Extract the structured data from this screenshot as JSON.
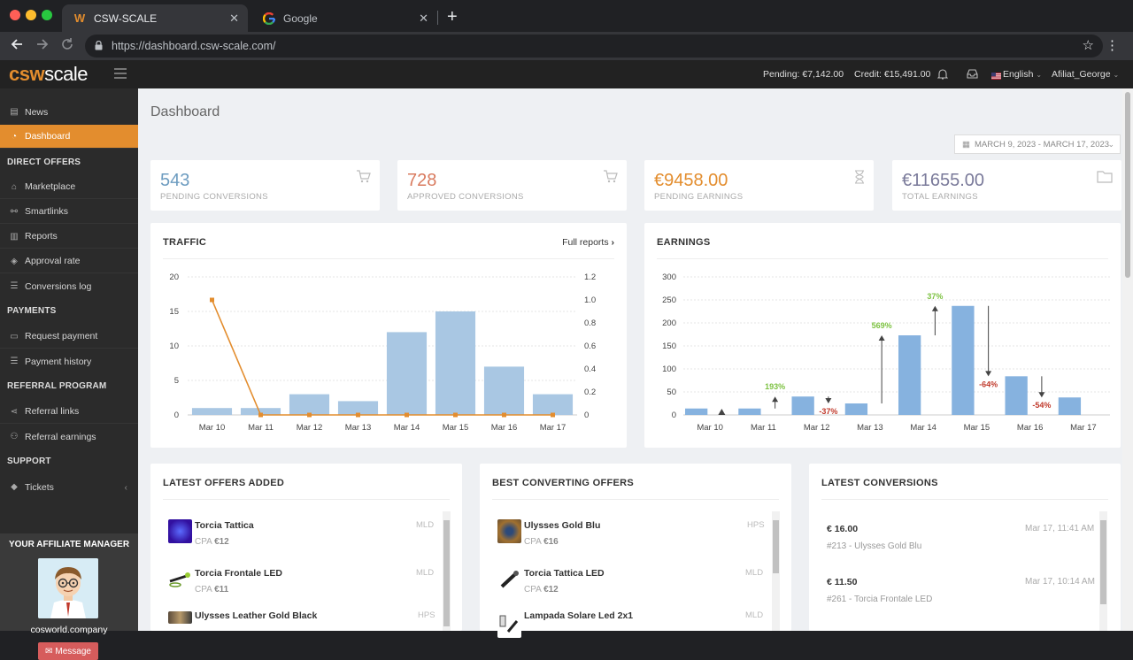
{
  "browser": {
    "tabs": [
      {
        "label": "CSW-SCALE",
        "active": true
      },
      {
        "label": "Google",
        "active": false
      }
    ],
    "url": "https://dashboard.csw-scale.com/"
  },
  "topbar": {
    "logo_left": "csw",
    "logo_right": "scale",
    "pending": "Pending: €7,142.00",
    "credit": "Credit: €15,491.00",
    "language": "English",
    "user": "Afiliat_George"
  },
  "sidebar": {
    "items": [
      {
        "label": "News",
        "icon": "newspaper-icon"
      },
      {
        "label": "Dashboard",
        "icon": "dashboard-icon",
        "active": true
      }
    ],
    "sections": [
      {
        "title": "DIRECT OFFERS",
        "items": [
          "Marketplace",
          "Smartlinks",
          "Reports",
          "Approval rate",
          "Conversions log"
        ]
      },
      {
        "title": "PAYMENTS",
        "items": [
          "Request payment",
          "Payment history"
        ]
      },
      {
        "title": "REFERRAL PROGRAM",
        "items": [
          "Referral links",
          "Referral earnings"
        ]
      },
      {
        "title": "SUPPORT",
        "items": [
          "Tickets"
        ]
      }
    ],
    "manager": {
      "title": "YOUR AFFILIATE MANAGER",
      "name": "cosworld.company",
      "button": "Message"
    }
  },
  "main": {
    "title": "Dashboard",
    "date_range": "MARCH 9, 2023 - MARCH 17, 2023",
    "stats": [
      {
        "value": "543",
        "label": "PENDING CONVERSIONS",
        "color": "#6d9cc0"
      },
      {
        "value": "728",
        "label": "APPROVED CONVERSIONS",
        "color": "#d97b5f"
      },
      {
        "value": "€9458.00",
        "label": "PENDING EARNINGS",
        "color": "#e38d2e"
      },
      {
        "value": "€11655.00",
        "label": "TOTAL EARNINGS",
        "color": "#7a7a9a"
      }
    ],
    "traffic_title": "TRAFFIC",
    "full_reports": "Full reports",
    "earnings_title": "EARNINGS",
    "latest_offers": {
      "title": "LATEST OFFERS ADDED",
      "rows": [
        {
          "name": "Torcia Tattica",
          "cpa_label": "CPA",
          "cpa": "€12",
          "geo": "MLD"
        },
        {
          "name": "Torcia Frontale LED",
          "cpa_label": "CPA",
          "cpa": "€11",
          "geo": "MLD"
        },
        {
          "name": "Ulysses Leather Gold Black",
          "cpa_label": "",
          "cpa": "",
          "geo": "HPS"
        }
      ]
    },
    "best_offers": {
      "title": "BEST CONVERTING OFFERS",
      "rows": [
        {
          "name": "Ulysses Gold Blu",
          "cpa_label": "CPA",
          "cpa": "€16",
          "geo": "HPS"
        },
        {
          "name": "Torcia Tattica LED",
          "cpa_label": "CPA",
          "cpa": "€12",
          "geo": "MLD"
        },
        {
          "name": "Lampada Solare Led 2x1",
          "cpa_label": "",
          "cpa": "",
          "geo": "MLD"
        }
      ]
    },
    "latest_conversions": {
      "title": "LATEST CONVERSIONS",
      "rows": [
        {
          "amount": "€ 16.00",
          "date": "Mar 17, 11:41 AM",
          "desc": "#213 - Ulysses Gold Blu"
        },
        {
          "amount": "€ 11.50",
          "date": "Mar 17, 10:14 AM",
          "desc": "#261 - Torcia Frontale LED"
        }
      ]
    }
  },
  "chart_data": [
    {
      "type": "bar",
      "title": "TRAFFIC",
      "categories": [
        "Mar 10",
        "Mar 11",
        "Mar 12",
        "Mar 13",
        "Mar 14",
        "Mar 15",
        "Mar 16",
        "Mar 17"
      ],
      "series": [
        {
          "values": [
            1,
            1,
            3,
            2,
            12,
            15,
            7,
            3
          ],
          "axis": "left",
          "type": "bar",
          "color": "#a9c7e3"
        },
        {
          "values": [
            1.0,
            0,
            0,
            0,
            0,
            0,
            0,
            0
          ],
          "axis": "right",
          "type": "line",
          "color": "#e38d2e"
        }
      ],
      "ylim": [
        0,
        20
      ],
      "yticks": [
        0,
        5,
        10,
        15,
        20
      ],
      "y2lim": [
        0,
        1.2
      ],
      "y2ticks": [
        "0",
        "0.2",
        "0.4",
        "0.6",
        "0.8",
        "1.0",
        "1.2"
      ],
      "grid": true
    },
    {
      "type": "bar",
      "title": "EARNINGS",
      "categories": [
        "Mar 10",
        "Mar 11",
        "Mar 12",
        "Mar 13",
        "Mar 14",
        "Mar 15",
        "Mar 16",
        "Mar 17"
      ],
      "values": [
        14,
        14,
        40,
        25,
        173,
        237,
        84,
        38
      ],
      "changes": [
        "",
        "193%",
        "-37%",
        "569%",
        "37%",
        "-64%",
        "-54%",
        ""
      ],
      "ylim": [
        0,
        300
      ],
      "yticks": [
        0,
        50,
        100,
        150,
        200,
        250,
        300
      ],
      "color": "#86b2df",
      "up_color": "#7dc242",
      "down_color": "#c0392b",
      "grid": true
    }
  ]
}
